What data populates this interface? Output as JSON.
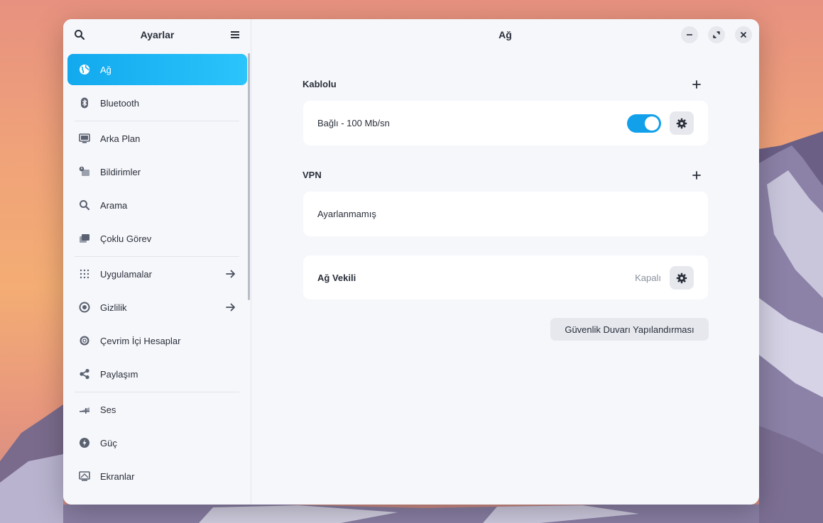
{
  "sidebar": {
    "title": "Ayarlar",
    "search_icon": "search-icon",
    "menu_icon": "hamburger-menu-icon",
    "items": [
      {
        "label": "Ağ",
        "icon": "globe-icon",
        "active": true
      },
      {
        "label": "Bluetooth",
        "icon": "bluetooth-icon"
      },
      {
        "label": "Arka Plan",
        "icon": "monitor-icon"
      },
      {
        "label": "Bildirimler",
        "icon": "notifications-icon"
      },
      {
        "label": "Arama",
        "icon": "search-icon"
      },
      {
        "label": "Çoklu Görev",
        "icon": "multitasking-icon"
      },
      {
        "label": "Uygulamalar",
        "icon": "apps-grid-icon"
      },
      {
        "label": "Gizlilik",
        "icon": "privacy-icon"
      },
      {
        "label": "Çevrim İçi Hesaplar",
        "icon": "at-sign-icon"
      },
      {
        "label": "Paylaşım",
        "icon": "share-icon"
      },
      {
        "label": "Ses",
        "icon": "sound-icon"
      },
      {
        "label": "Güç",
        "icon": "power-icon"
      },
      {
        "label": "Ekranlar",
        "icon": "display-icon"
      }
    ]
  },
  "header": {
    "title": "Ağ"
  },
  "wired": {
    "title": "Kablolu",
    "connection_label": "Bağlı - 100 Mb/sn",
    "enabled": true
  },
  "vpn": {
    "title": "VPN",
    "status_label": "Ayarlanmamış"
  },
  "proxy": {
    "title": "Ağ Vekili",
    "status": "Kapalı"
  },
  "firewall_button": "Güvenlik Duvarı Yapılandırması",
  "colors": {
    "accent": "#12a9ee",
    "window_bg": "#f6f7fb",
    "card_bg": "#ffffff"
  }
}
